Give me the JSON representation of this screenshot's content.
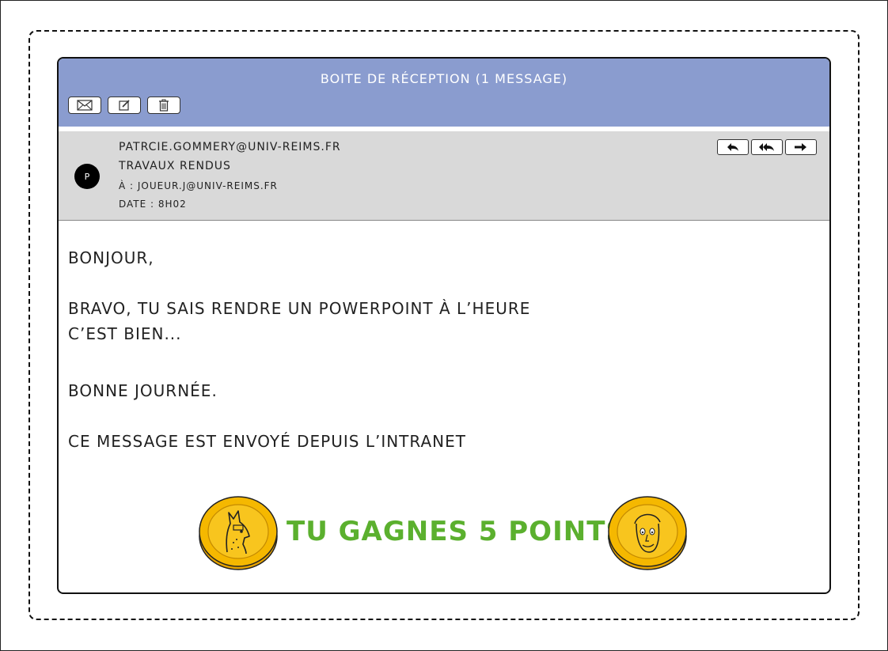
{
  "window": {
    "title": "BOITE DE RÉCEPTION  (1 MESSAGE)"
  },
  "toolbar": {
    "buttons": [
      {
        "icon": "mail-icon"
      },
      {
        "icon": "compose-icon"
      },
      {
        "icon": "trash-icon"
      }
    ]
  },
  "message": {
    "avatar_letter": "P",
    "from": "patrcie.gommery@univ-reims.fr",
    "subject": "TRAVAUX RENDUS",
    "to": "À : joueur.j@univ-reims.fr",
    "date": "DATE : 8H02",
    "actions": [
      {
        "icon": "reply-icon"
      },
      {
        "icon": "reply-all-icon"
      },
      {
        "icon": "forward-icon"
      }
    ],
    "body": {
      "greeting": "Bonjour,",
      "line1": "Bravo, tu sais rendre un powerpoint à l’heure",
      "line2": "C’est bien...",
      "closing": "Bonne journée.",
      "signature": "Ce message est envoyé depuis l’intranet"
    }
  },
  "reward": {
    "text": "TU GAGNES 5 POINTS!!",
    "color": "#5bb02e",
    "left_coin_icon": "llama-coin-icon",
    "right_coin_icon": "face-coin-icon"
  },
  "colors": {
    "title_bar": "#8a9ccf",
    "header_bg": "#d9d9d9",
    "coin_gold": "#f5b800"
  }
}
